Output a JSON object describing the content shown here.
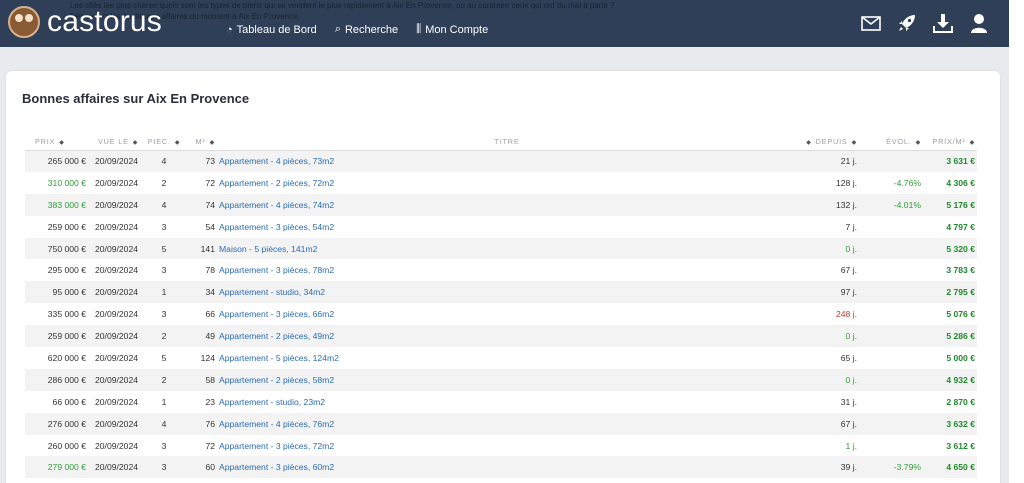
{
  "header": {
    "brand": "castorus",
    "ghost_text": [
      "Les cités les plus chères quels sont les types de biens qui se vendent le plus rapidement à Aix En Provence, ou au contraire ceux qui ont du mal à partir ?",
      "Découvrez les meilleures affaires du moment à Aix En Provence."
    ],
    "nav": [
      {
        "label": "Tableau de Bord",
        "icon": "dashboard-icon",
        "glyph": "◔"
      },
      {
        "label": "Recherche",
        "icon": "search-icon",
        "glyph": "⌕"
      },
      {
        "label": "Mon Compte",
        "icon": "sliders-icon",
        "glyph": "⫼"
      }
    ],
    "right_icons": [
      "mail-icon",
      "rocket-icon",
      "download-icon",
      "user-icon"
    ]
  },
  "page": {
    "title": "Bonnes affaires sur Aix En Provence"
  },
  "table": {
    "headers": {
      "prix": "PRIX",
      "vue_le": "VUE LE",
      "pieces": "PIEC.",
      "m2": "M²",
      "titre": "TITRE",
      "depuis": "DEPUIS",
      "evol": "ÉVOL.",
      "prix_m2": "PRIX/M²"
    },
    "rows": [
      {
        "prix": "265 000 €",
        "prix_color": "gray",
        "date": "20/09/2024",
        "pieces": "4",
        "m2": "73",
        "titre": "Appartement - 4 pièces, 73m2",
        "depuis": "21 j.",
        "depuis_color": "gray",
        "evol": "",
        "prix_m2": "3 631 €"
      },
      {
        "prix": "310 000 €",
        "prix_color": "green",
        "date": "20/09/2024",
        "pieces": "2",
        "m2": "72",
        "titre": "Appartement - 2 pièces, 72m2",
        "depuis": "128 j.",
        "depuis_color": "gray",
        "evol": "-4.76%",
        "prix_m2": "4 306 €"
      },
      {
        "prix": "383 000 €",
        "prix_color": "green",
        "date": "20/09/2024",
        "pieces": "4",
        "m2": "74",
        "titre": "Appartement - 4 pièces, 74m2",
        "depuis": "132 j.",
        "depuis_color": "gray",
        "evol": "-4.01%",
        "prix_m2": "5 176 €"
      },
      {
        "prix": "259 000 €",
        "prix_color": "gray",
        "date": "20/09/2024",
        "pieces": "3",
        "m2": "54",
        "titre": "Appartement - 3 pièces, 54m2",
        "depuis": "7 j.",
        "depuis_color": "gray",
        "evol": "",
        "prix_m2": "4 797 €"
      },
      {
        "prix": "750 000 €",
        "prix_color": "gray",
        "date": "20/09/2024",
        "pieces": "5",
        "m2": "141",
        "titre": "Maison - 5 pièces, 141m2",
        "depuis": "0 j.",
        "depuis_color": "green",
        "evol": "",
        "prix_m2": "5 320 €"
      },
      {
        "prix": "295 000 €",
        "prix_color": "gray",
        "date": "20/09/2024",
        "pieces": "3",
        "m2": "78",
        "titre": "Appartement - 3 pièces, 78m2",
        "depuis": "67 j.",
        "depuis_color": "gray",
        "evol": "",
        "prix_m2": "3 783 €"
      },
      {
        "prix": "95 000 €",
        "prix_color": "gray",
        "date": "20/09/2024",
        "pieces": "1",
        "m2": "34",
        "titre": "Appartement - studio, 34m2",
        "depuis": "97 j.",
        "depuis_color": "gray",
        "evol": "",
        "prix_m2": "2 795 €"
      },
      {
        "prix": "335 000 €",
        "prix_color": "gray",
        "date": "20/09/2024",
        "pieces": "3",
        "m2": "66",
        "titre": "Appartement - 3 pièces, 66m2",
        "depuis": "248 j.",
        "depuis_color": "red",
        "evol": "",
        "prix_m2": "5 076 €"
      },
      {
        "prix": "259 000 €",
        "prix_color": "gray",
        "date": "20/09/2024",
        "pieces": "2",
        "m2": "49",
        "titre": "Appartement - 2 pièces, 49m2",
        "depuis": "0 j.",
        "depuis_color": "green",
        "evol": "",
        "prix_m2": "5 286 €"
      },
      {
        "prix": "620 000 €",
        "prix_color": "gray",
        "date": "20/09/2024",
        "pieces": "5",
        "m2": "124",
        "titre": "Appartement - 5 pièces, 124m2",
        "depuis": "65 j.",
        "depuis_color": "gray",
        "evol": "",
        "prix_m2": "5 000 €"
      },
      {
        "prix": "286 000 €",
        "prix_color": "gray",
        "date": "20/09/2024",
        "pieces": "2",
        "m2": "58",
        "titre": "Appartement - 2 pièces, 58m2",
        "depuis": "0 j.",
        "depuis_color": "green",
        "evol": "",
        "prix_m2": "4 932 €"
      },
      {
        "prix": "66 000 €",
        "prix_color": "gray",
        "date": "20/09/2024",
        "pieces": "1",
        "m2": "23",
        "titre": "Appartement - studio, 23m2",
        "depuis": "31 j.",
        "depuis_color": "gray",
        "evol": "",
        "prix_m2": "2 870 €"
      },
      {
        "prix": "276 000 €",
        "prix_color": "gray",
        "date": "20/09/2024",
        "pieces": "4",
        "m2": "76",
        "titre": "Appartement - 4 pièces, 76m2",
        "depuis": "67 j.",
        "depuis_color": "gray",
        "evol": "",
        "prix_m2": "3 632 €"
      },
      {
        "prix": "260 000 €",
        "prix_color": "gray",
        "date": "20/09/2024",
        "pieces": "3",
        "m2": "72",
        "titre": "Appartement - 3 pièces, 72m2",
        "depuis": "1 j.",
        "depuis_color": "green",
        "evol": "",
        "prix_m2": "3 612 €"
      },
      {
        "prix": "279 000 €",
        "prix_color": "green",
        "date": "20/09/2024",
        "pieces": "3",
        "m2": "60",
        "titre": "Appartement - 3 pièces, 60m2",
        "depuis": "39 j.",
        "depuis_color": "gray",
        "evol": "-3.79%",
        "prix_m2": "4 650 €"
      }
    ]
  },
  "colors": {
    "navbar": "#2f3f57",
    "link": "#2b6cb0",
    "positive": "#2e9e3a",
    "price_m2": "#1f8b2a",
    "alert": "#c0392b"
  }
}
